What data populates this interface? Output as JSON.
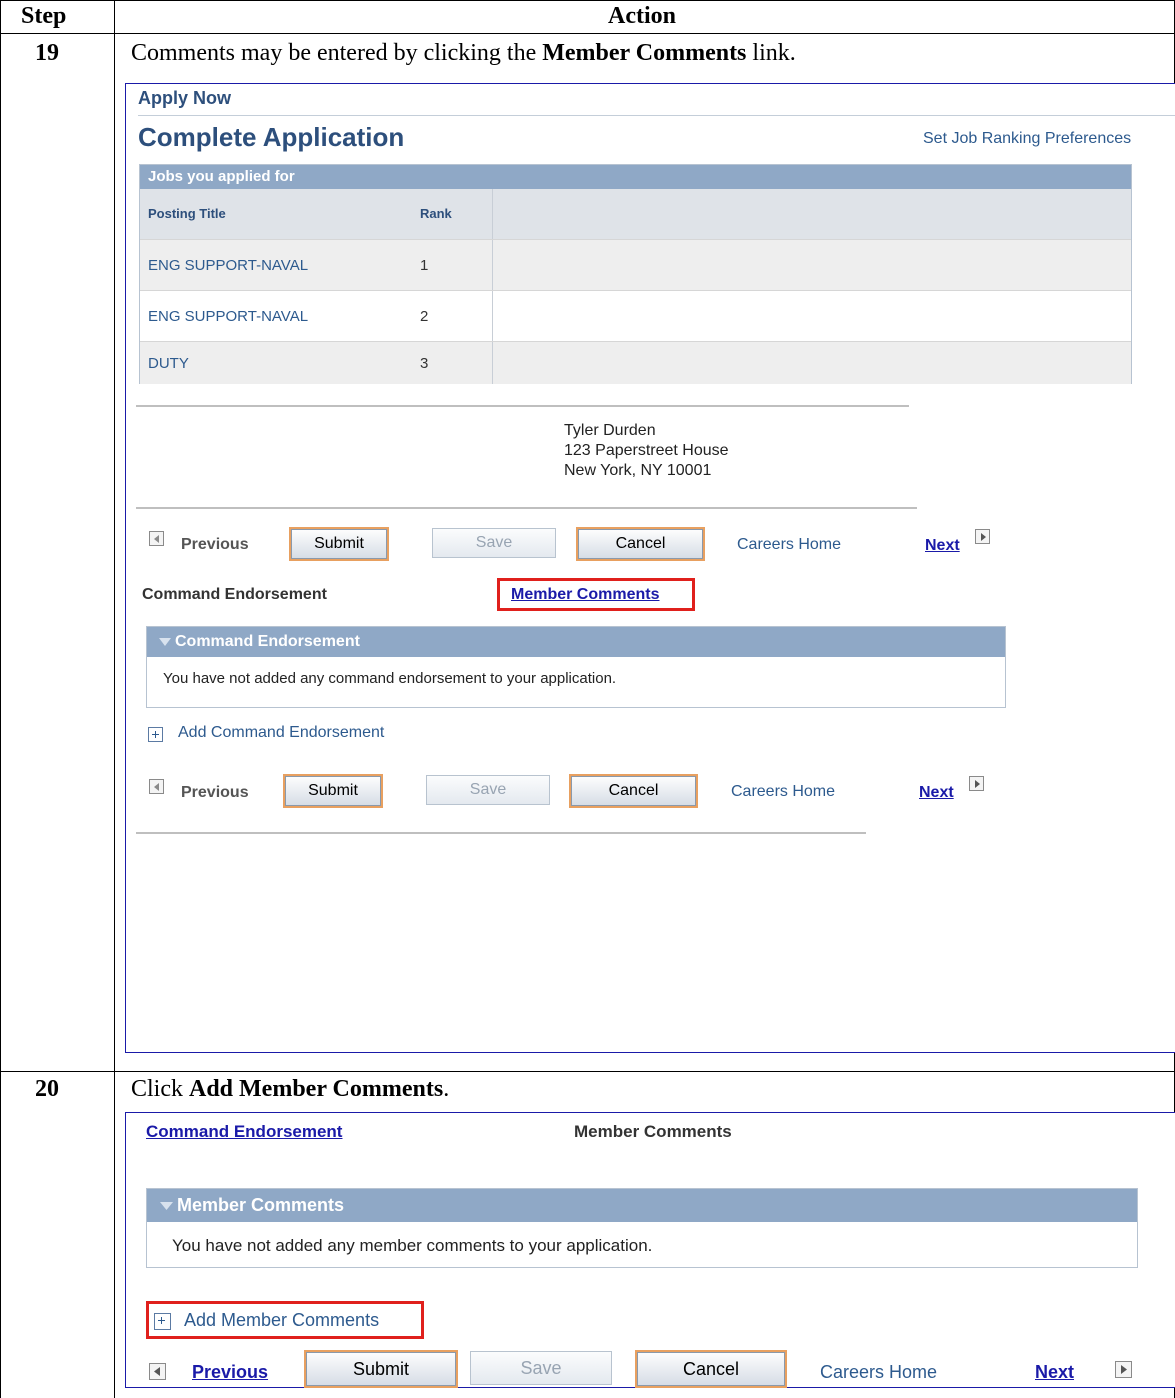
{
  "table": {
    "header_step": "Step",
    "header_action": "Action"
  },
  "step19": {
    "number": "19",
    "instruction_pre": "Comments may be entered by clicking the ",
    "instruction_bold": "Member Comments",
    "instruction_post": " link.",
    "app": {
      "apply_now": "Apply Now",
      "page_title": "Complete Application",
      "job_ranking_link": "Set Job Ranking Preferences",
      "grid_title": "Jobs you applied for",
      "col_posting": "Posting Title",
      "col_rank": "Rank",
      "rows": [
        {
          "title": "ENG SUPPORT-NAVAL",
          "rank": "1"
        },
        {
          "title": "ENG SUPPORT-NAVAL",
          "rank": "2"
        },
        {
          "title": "DUTY",
          "rank": "3"
        }
      ],
      "address": {
        "name": "Tyler Durden",
        "street": "123 Paperstreet House",
        "city": "New York, NY  10001"
      },
      "nav": {
        "previous": "Previous",
        "submit": "Submit",
        "save": "Save",
        "cancel": "Cancel",
        "careers_home": "Careers Home",
        "next": "Next"
      },
      "command_endorsement_label": "Command Endorsement",
      "member_comments_link": "Member Comments",
      "section_title": "Command Endorsement",
      "section_message": "You have not added any command endorsement to your application.",
      "add_link": "Add Command Endorsement"
    }
  },
  "step20": {
    "number": "20",
    "instruction_pre": "Click ",
    "instruction_bold": "Add Member Comments",
    "instruction_post": ".",
    "app": {
      "command_endorsement_link": "Command Endorsement",
      "member_comments_label": "Member Comments",
      "section_title": "Member Comments",
      "section_message": "You have not added any member comments to your application.",
      "add_link": "Add Member Comments",
      "nav": {
        "previous": "Previous",
        "submit": "Submit",
        "save": "Save",
        "cancel": "Cancel",
        "careers_home": "Careers Home",
        "next": "Next"
      }
    }
  },
  "colors": {
    "grid_header": "#8fa8c6",
    "link": "#2d5a8e",
    "highlight": "#e0201c"
  }
}
